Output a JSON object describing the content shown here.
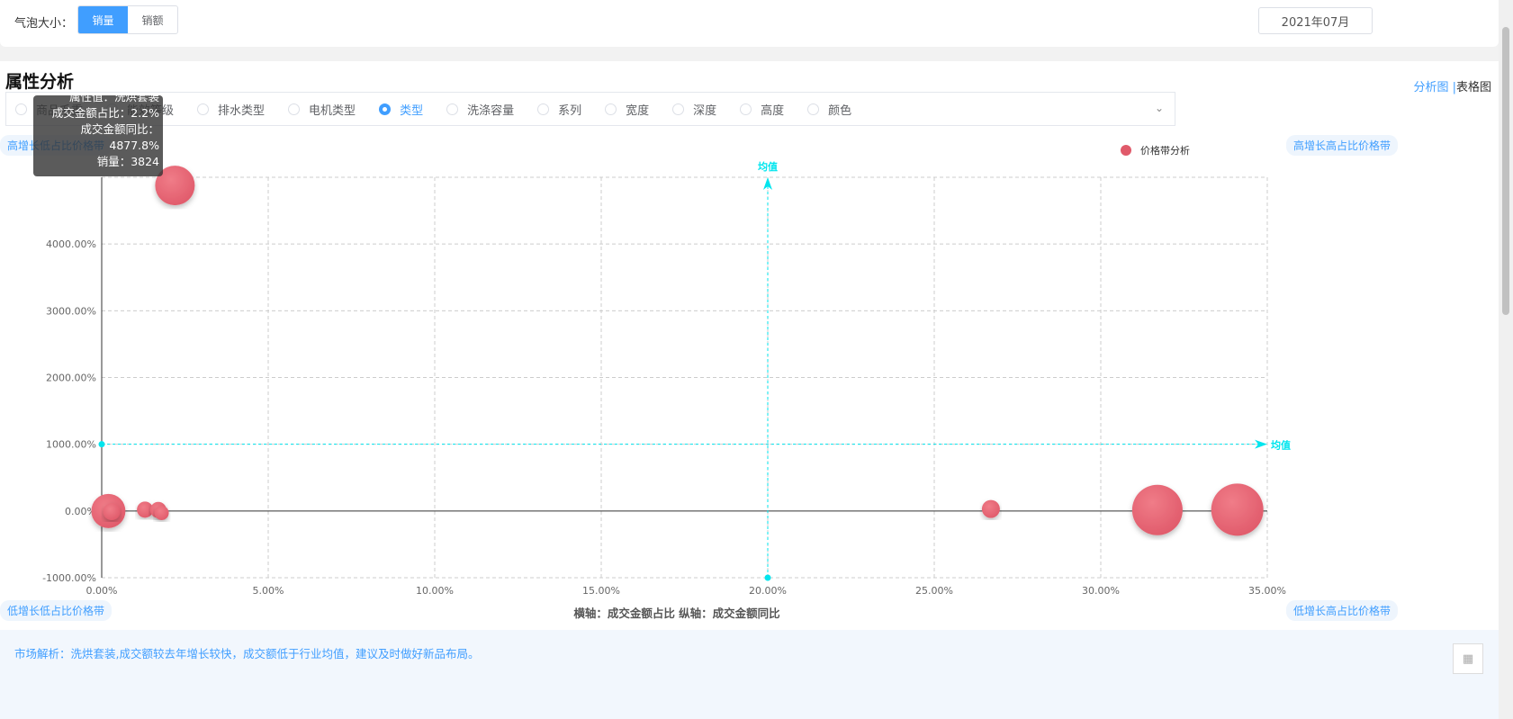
{
  "top": {
    "bubble_label": "气泡大小：",
    "options": [
      "销量",
      "销额"
    ],
    "selected": "销量",
    "date": "2021年07月"
  },
  "section": {
    "title": "属性分析",
    "view_chart": "分析图",
    "view_sep": "|",
    "view_table": "表格图"
  },
  "attributes": {
    "items": [
      "商品毛重",
      "能效等级",
      "排水类型",
      "电机类型",
      "类型",
      "洗涤容量",
      "系列",
      "宽度",
      "深度",
      "高度",
      "颜色"
    ],
    "selected": "类型"
  },
  "quadrants": {
    "tl": "高增长低占比价格带",
    "tr": "高增长高占比价格带",
    "bl": "低增长低占比价格带",
    "br": "低增长高占比价格带"
  },
  "tooltip": {
    "l1": "属性值：洗烘套装",
    "l2": "成交金额占比：2.2%",
    "l3": "成交金额同比：4877.8%",
    "l4": "销量：3824"
  },
  "footer": {
    "text": "市场解析：洗烘套装,成交额较去年增长较快，成交额低于行业均值，建议及时做好新品布局。"
  },
  "chart_data": {
    "type": "scatter",
    "xlabel": "横轴：成交金额占比  纵轴：成交金额同比",
    "legend": "价格带分析",
    "legend_position": "top-right",
    "color": "#e05a6a",
    "mean_color": "#00e5ee",
    "xlim": [
      0,
      35
    ],
    "ylim": [
      -1000,
      5000
    ],
    "x_ticks": [
      "0.00%",
      "5.00%",
      "10.00%",
      "15.00%",
      "20.00%",
      "25.00%",
      "30.00%",
      "35.00%"
    ],
    "y_ticks": [
      "-1000.00%",
      "0.00%",
      "1000.00%",
      "2000.00%",
      "3000.00%",
      "4000.00%"
    ],
    "mean_x": 20,
    "mean_y": 1000,
    "mean_label": "均值",
    "grid": true,
    "points": [
      {
        "x": 2.2,
        "y": 4877.8,
        "size": 3824
      },
      {
        "x": 0.2,
        "y": 0,
        "size": 2850
      },
      {
        "x": 0.3,
        "y": -10,
        "size": 700
      },
      {
        "x": 1.3,
        "y": 20,
        "size": 640
      },
      {
        "x": 1.7,
        "y": 15,
        "size": 640
      },
      {
        "x": 1.8,
        "y": -30,
        "size": 500
      },
      {
        "x": 26.7,
        "y": 30,
        "size": 790
      },
      {
        "x": 31.7,
        "y": 15,
        "size": 6200
      },
      {
        "x": 34.1,
        "y": 20,
        "size": 6640
      }
    ]
  }
}
